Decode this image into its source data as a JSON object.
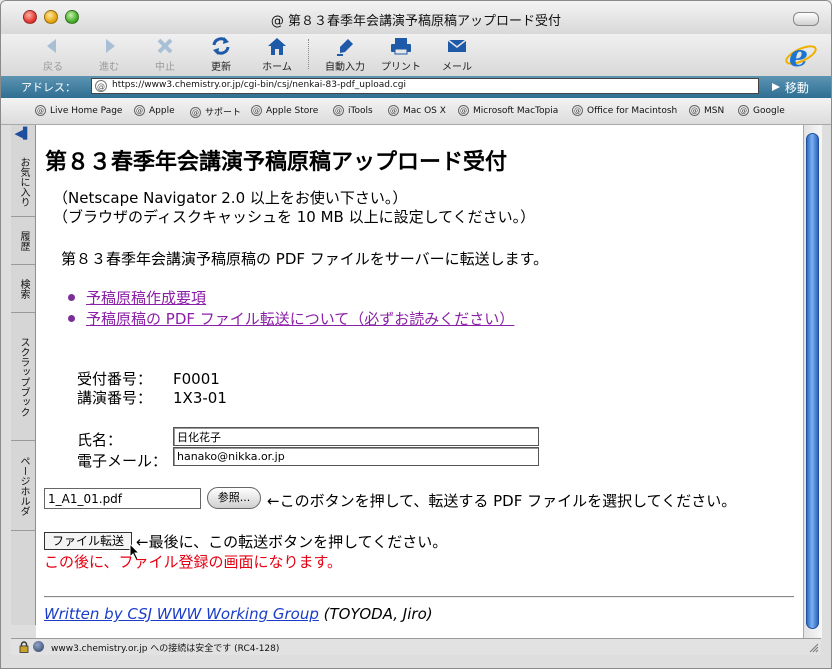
{
  "window": {
    "title": "@ 第８３春季年会講演予稿原稿アップロード受付"
  },
  "toolbar": {
    "buttons": [
      {
        "label": "戻る",
        "icon": "back-arrow-icon"
      },
      {
        "label": "進む",
        "icon": "forward-arrow-icon"
      },
      {
        "label": "中止",
        "icon": "stop-icon"
      },
      {
        "label": "更新",
        "icon": "refresh-icon"
      },
      {
        "label": "ホーム",
        "icon": "home-icon"
      },
      {
        "label": "自動入力",
        "icon": "autofill-icon"
      },
      {
        "label": "プリント",
        "icon": "print-icon"
      },
      {
        "label": "メール",
        "icon": "mail-icon"
      }
    ]
  },
  "address": {
    "label": "アドレス：",
    "url": "https://www3.chemistry.or.jp/cgi-bin/csj/nenkai-83-pdf_upload.cgi",
    "go_label": "移動"
  },
  "favorites": [
    "Live Home Page",
    "Apple",
    "サポート",
    "Apple Store",
    "iTools",
    "Mac OS X",
    "Microsoft MacTopia",
    "Office for Macintosh",
    "MSN",
    "Google"
  ],
  "sidebar": {
    "tabs": [
      "お気に入り",
      "履歴",
      "検索",
      "スクラップブック",
      "ページホルダ"
    ]
  },
  "page": {
    "title": "第８３春季年会講演予稿原稿アップロード受付",
    "note1": "（Netscape Navigator 2.0 以上をお使い下さい。）",
    "note2": "（ブラウザのディスクキャッシュを 10 MB 以上に設定してください。）",
    "intro": "第８３春季年会講演予稿原稿の PDF ファイルをサーバーに転送します。",
    "links": [
      "予稿原稿作成要項",
      "予稿原稿の PDF ファイル転送について（必ずお読みください）"
    ],
    "receipt_label": "受付番号：",
    "receipt_value": "F0001",
    "lecture_label": "講演番号：",
    "lecture_value": "1X3-01",
    "name_label": "氏名：",
    "name_value": "日化花子",
    "email_label": "電子メール：",
    "email_value": "hanako@nikka.or.jp",
    "file_value": "1_A1_01.pdf",
    "browse_label": "参照...",
    "browse_help": "←このボタンを押して、転送する PDF ファイルを選択してください。",
    "submit_label": "ファイル転送",
    "submit_help": "←最後に、この転送ボタンを押してください。",
    "warning": "この後に、ファイル登録の画面になります。",
    "footer_link": "Written by CSJ WWW Working Group",
    "footer_rest": " (TOYODA, Jiro)"
  },
  "status": {
    "text": "www3.chemistry.or.jp への接続は安全です (RC4-128)"
  },
  "colors": {
    "link_visited": "#8b1fa8",
    "link": "#1a3cc8",
    "warning": "#e60012",
    "address_bar": "#3a7ea3"
  }
}
